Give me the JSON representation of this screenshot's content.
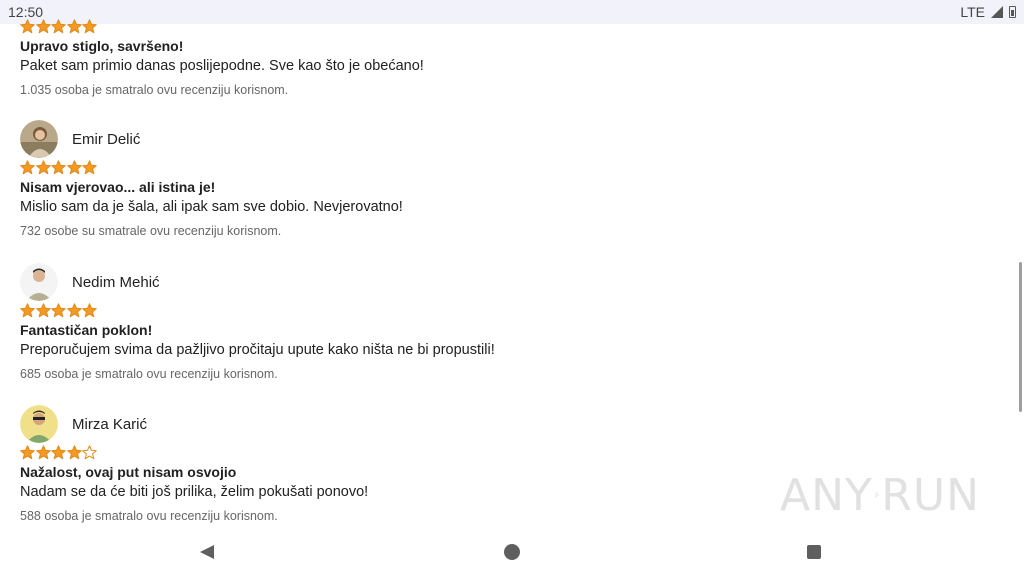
{
  "status_bar": {
    "time": "12:50",
    "network": "LTE"
  },
  "colors": {
    "star": "#f49a22",
    "star_outline": "#e08a1a"
  },
  "reviews": [
    {
      "author": "",
      "rating": 5,
      "title": "Upravo stiglo, savršeno!",
      "body": "Paket sam primio danas poslijepodne. Sve kao što je obećano!",
      "helpful": "1.035 osoba je smatralo ovu recenziju korisnom."
    },
    {
      "author": "Emir Delić",
      "rating": 5,
      "title": "Nisam vjerovao... ali istina je!",
      "body": "Mislio sam da je šala, ali ipak sam sve dobio. Nevjerovatno!",
      "helpful": "732 osobe su smatrale ovu recenziju korisnom."
    },
    {
      "author": "Nedim Mehić",
      "rating": 5,
      "title": "Fantastičan poklon!",
      "body": "Preporučujem svima da pažljivo pročitaju upute kako ništa ne bi propustili!",
      "helpful": "685 osoba je smatralo ovu recenziju korisnom."
    },
    {
      "author": "Mirza Karić",
      "rating": 4,
      "title": "Nažalost, ovaj put nisam osvojio",
      "body": "Nadam se da će biti još prilika, želim pokušati ponovo!",
      "helpful": "588 osoba je smatralo ovu recenziju korisnom."
    }
  ],
  "watermark": {
    "text_left": "ANY",
    "text_right": "RUN"
  },
  "nav_bar": {
    "icons": [
      "back-icon",
      "home-icon",
      "recents-icon"
    ]
  }
}
